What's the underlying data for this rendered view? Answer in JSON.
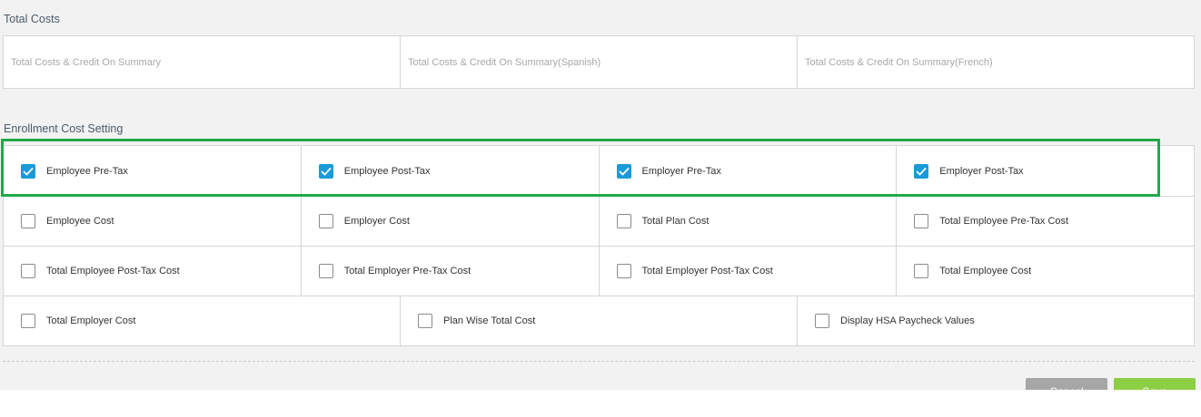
{
  "total_costs": {
    "title": "Total Costs",
    "fields": [
      {
        "placeholder": "Total Costs & Credit On Summary"
      },
      {
        "placeholder": "Total Costs & Credit On Summary(Spanish)"
      },
      {
        "placeholder": "Total Costs & Credit On Summary(French)"
      }
    ]
  },
  "enrollment": {
    "title": "Enrollment Cost Setting",
    "rows": [
      [
        {
          "label": "Employee Pre-Tax",
          "checked": true
        },
        {
          "label": "Employee Post-Tax",
          "checked": true
        },
        {
          "label": "Employer Pre-Tax",
          "checked": true
        },
        {
          "label": "Employer Post-Tax",
          "checked": true
        }
      ],
      [
        {
          "label": "Employee Cost",
          "checked": false
        },
        {
          "label": "Employer Cost",
          "checked": false
        },
        {
          "label": "Total Plan Cost",
          "checked": false
        },
        {
          "label": "Total Employee Pre-Tax Cost",
          "checked": false
        }
      ],
      [
        {
          "label": "Total Employee Post-Tax Cost",
          "checked": false
        },
        {
          "label": "Total Employer Pre-Tax Cost",
          "checked": false
        },
        {
          "label": "Total Employer Post-Tax Cost",
          "checked": false
        },
        {
          "label": "Total Employee Cost",
          "checked": false
        }
      ],
      [
        {
          "label": "Total Employer Cost",
          "checked": false
        },
        {
          "label": "Plan Wise Total Cost",
          "checked": false
        },
        {
          "label": "Display HSA Paycheck Values",
          "checked": false
        }
      ]
    ]
  },
  "footer": {
    "cancel_label": "Cancel",
    "save_label": "Save"
  },
  "colors": {
    "checkbox_checked": "#1a9ad8",
    "highlight": "#22a84a",
    "save_button": "#8cce44",
    "cancel_button": "#a6a6a6"
  }
}
